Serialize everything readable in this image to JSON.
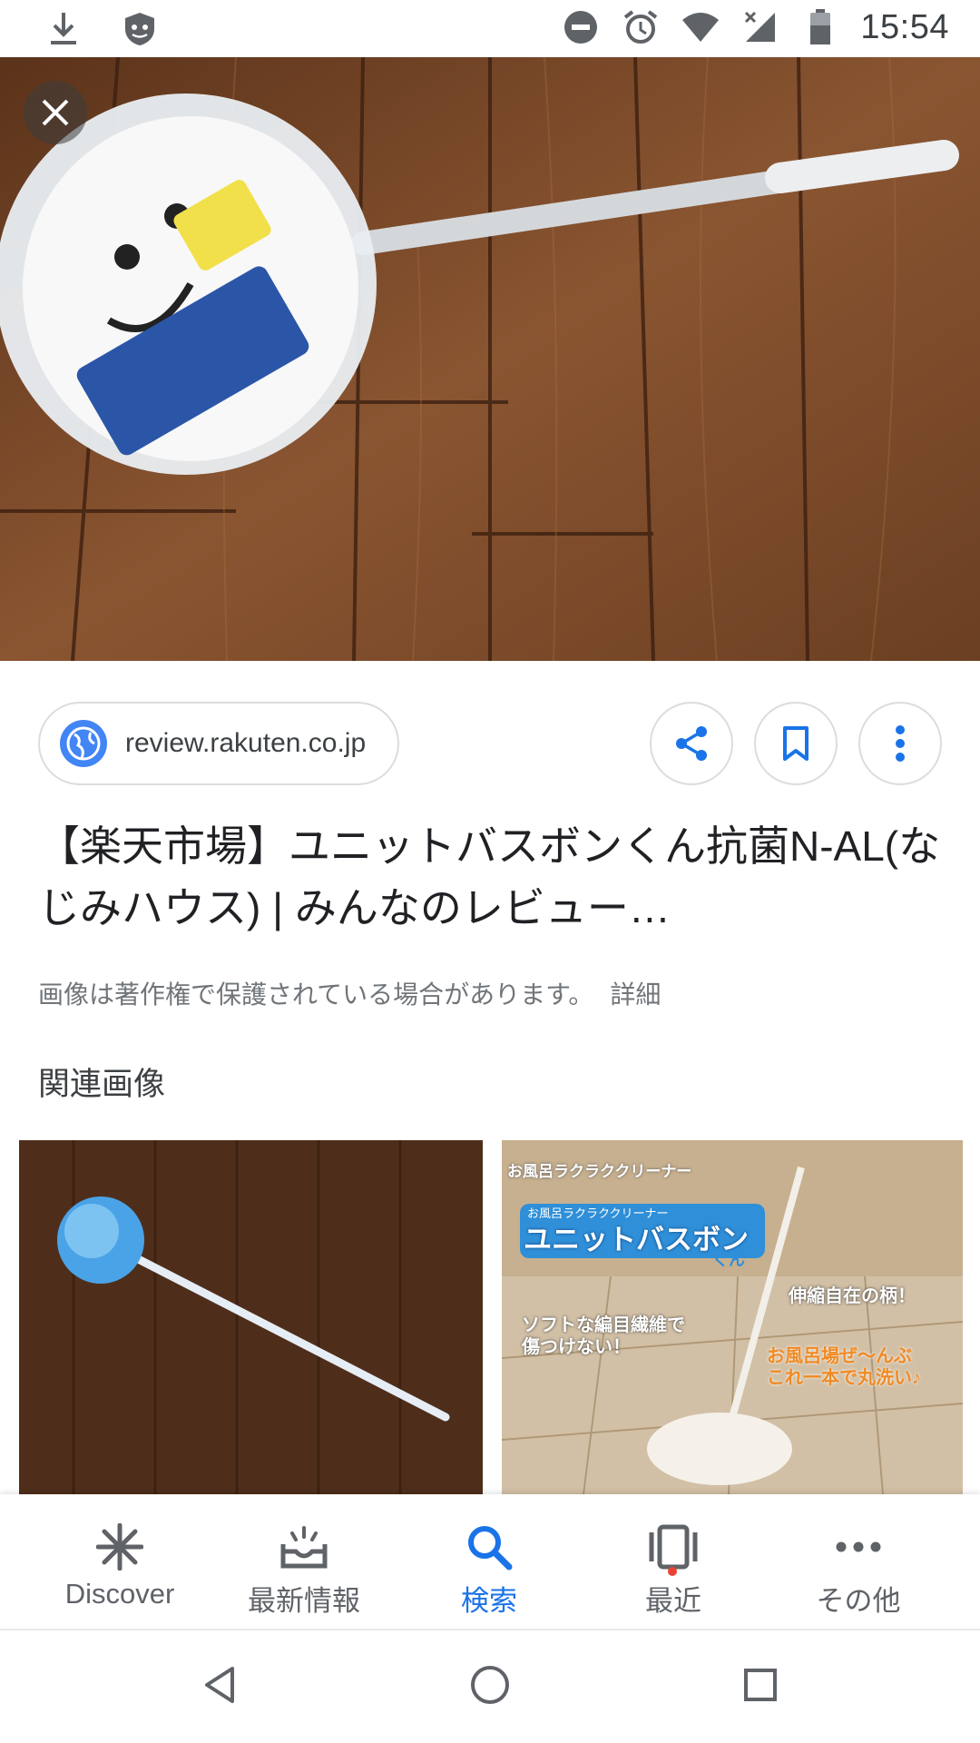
{
  "status_bar": {
    "time": "15:54",
    "icons_left": [
      "download-icon",
      "shield-app-icon"
    ],
    "icons_right": [
      "do-not-disturb-icon",
      "alarm-icon",
      "wifi-icon",
      "no-signal-icon",
      "battery-icon"
    ]
  },
  "viewer": {
    "close_icon": "close-icon",
    "source_site": "review.rakuten.co.jp",
    "actions": [
      "share-icon",
      "bookmark-icon",
      "more-vert-icon"
    ],
    "title": "【楽天市場】ユニットバスボンくん抗菌N-AL(なじみハウス) | みんなのレビュー…",
    "copyright_notice": "画像は著作権で保護されている場合があります。",
    "details_link": "詳細",
    "related_label": "関連画像"
  },
  "thumbnails": {
    "thumb2_text": {
      "banner": "お風呂ラクラククリーナー",
      "small": "お風呂ラクラククリーナー",
      "product": "ユニットバスボン",
      "kun": "くん",
      "feature1": "伸縮自在の柄！",
      "feature2_line1": "ソフトな編目繊維で",
      "feature2_line2": "傷つけない！",
      "feature3_line1": "お風呂場ぜ〜んぶ",
      "feature3_line2": "これ一本で丸洗い♪"
    }
  },
  "bottom_nav": {
    "items": [
      {
        "label": "Discover",
        "icon": "discover-asterisk-icon"
      },
      {
        "label": "最新情報",
        "icon": "updates-tray-icon"
      },
      {
        "label": "検索",
        "icon": "search-icon"
      },
      {
        "label": "最近",
        "icon": "recent-cards-icon"
      },
      {
        "label": "その他",
        "icon": "more-horiz-icon"
      }
    ],
    "active_index": 2,
    "accent_color": "#1a73e8"
  },
  "system_nav": [
    "back-icon",
    "home-icon",
    "overview-icon"
  ],
  "colors": {
    "accent": "#1a73e8",
    "text_primary": "#202124",
    "text_secondary": "#70757a",
    "notification_dot": "#ea4335"
  }
}
